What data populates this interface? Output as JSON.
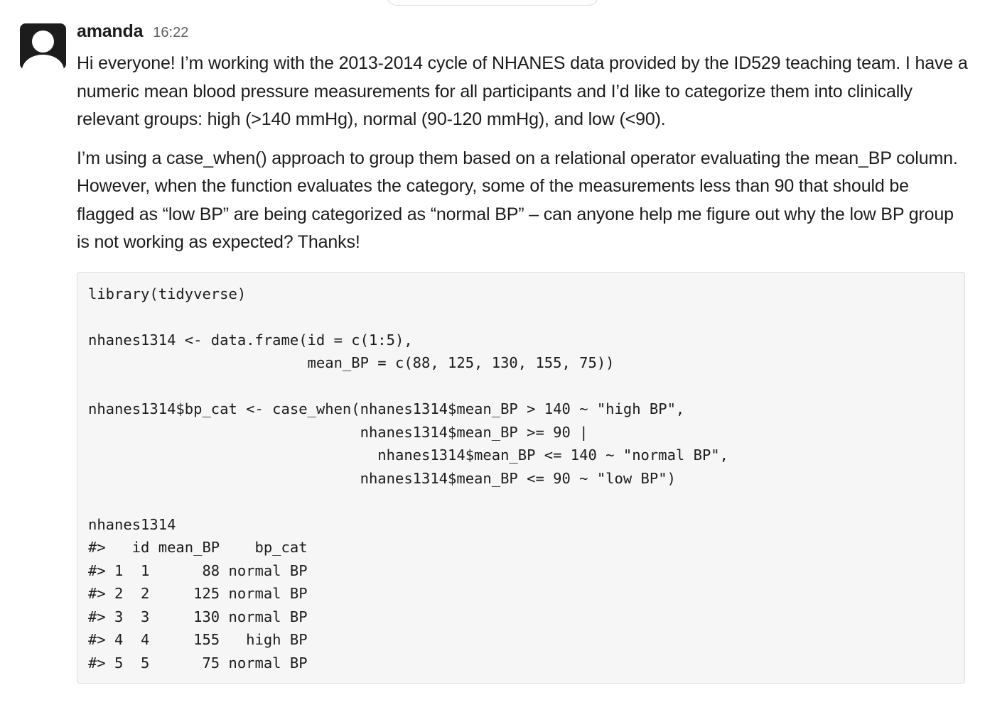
{
  "message": {
    "author": "amanda",
    "timestamp": "16:22",
    "paragraphs": [
      "Hi everyone! I’m working with the 2013-2014 cycle of NHANES data provided by the ID529 teaching team. I have a numeric mean blood pressure measurements for all participants and I’d like to categorize them into clinically relevant groups: high (>140 mmHg), normal (90-120 mmHg), and low (<90).",
      "I’m using a case_when() approach to group them based on a relational operator evaluating the mean_BP column. However, when the function evaluates the category, some of the measurements less than 90 that should be flagged as “low BP” are being categorized as “normal BP” – can anyone help me figure out why the low BP group is not working as expected? Thanks!"
    ],
    "code_lines": [
      "library(tidyverse)",
      "",
      "nhanes1314 <- data.frame(id = c(1:5),",
      "                         mean_BP = c(88, 125, 130, 155, 75))",
      "",
      "nhanes1314$bp_cat <- case_when(nhanes1314$mean_BP > 140 ~ \"high BP\",",
      "                               nhanes1314$mean_BP >= 90 |",
      "                                 nhanes1314$mean_BP <= 140 ~ \"normal BP\",",
      "                               nhanes1314$mean_BP <= 90 ~ \"low BP\")",
      "",
      "nhanes1314",
      "#>   id mean_BP    bp_cat",
      "#> 1  1      88 normal BP",
      "#> 2  2     125 normal BP",
      "#> 3  3     130 normal BP",
      "#> 4  4     155   high BP",
      "#> 5  5      75 normal BP"
    ]
  }
}
